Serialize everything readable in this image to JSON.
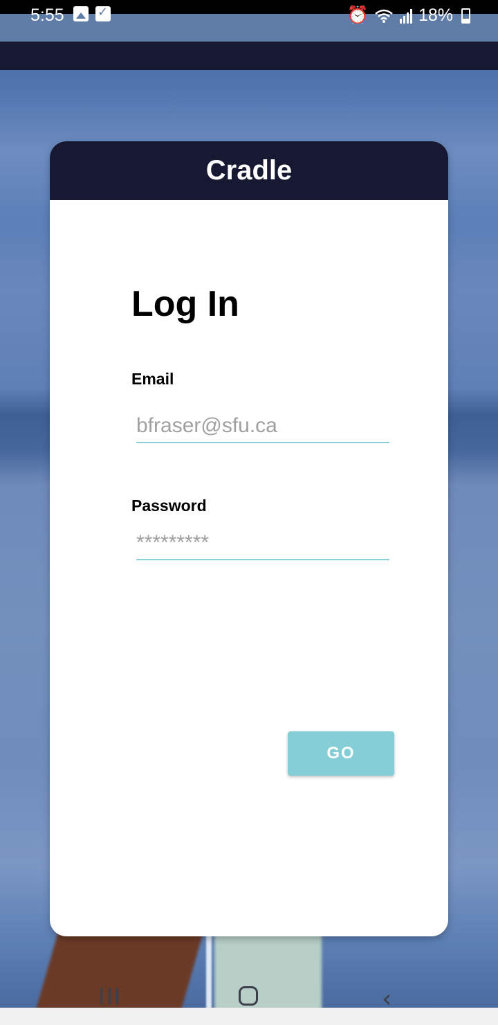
{
  "status_bar": {
    "time": "5:55",
    "battery": "18%",
    "icons_left": [
      "image-icon",
      "checkbox-icon"
    ],
    "icons_right": [
      "alarm-icon",
      "wifi-icon",
      "signal-icon",
      "battery-icon"
    ]
  },
  "card": {
    "title": "Cradle",
    "heading": "Log In",
    "email": {
      "label": "Email",
      "placeholder": "bfraser@sfu.ca",
      "value": ""
    },
    "password": {
      "label": "Password",
      "placeholder": "*********",
      "value": ""
    },
    "submit_label": "GO"
  },
  "colors": {
    "header_bg": "#161931",
    "accent": "#85ced6",
    "input_underline": "#89cfd6"
  },
  "nav_bar": {
    "icons": [
      "recent-apps-icon",
      "home-icon",
      "back-icon"
    ]
  }
}
